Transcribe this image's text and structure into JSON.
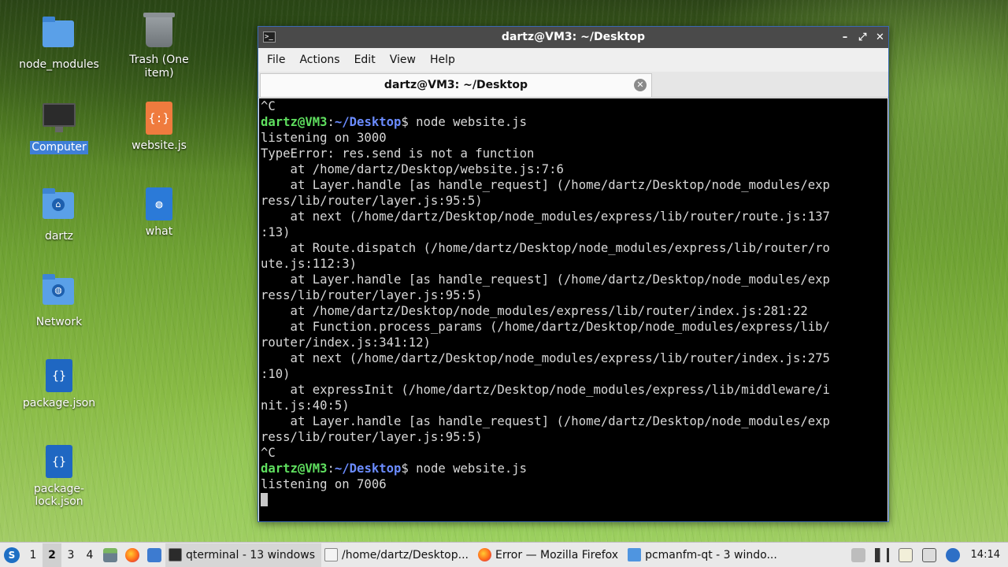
{
  "desktop": {
    "icons": [
      {
        "label": "node_modules"
      },
      {
        "label": "Trash (One item)"
      },
      {
        "label": "Computer"
      },
      {
        "label": "website.js"
      },
      {
        "label": "dartz"
      },
      {
        "label": "what"
      },
      {
        "label": "Network"
      },
      {
        "label": "package.json"
      },
      {
        "label": "package-lock.json"
      }
    ]
  },
  "window": {
    "title": "dartz@VM3: ~/Desktop",
    "controls": {
      "minimize": "–",
      "maximize": "⤢",
      "close": "✕"
    },
    "menu": [
      "File",
      "Actions",
      "Edit",
      "View",
      "Help"
    ],
    "tab_title": "dartz@VM3: ~/Desktop",
    "tab_close": "✕"
  },
  "terminal": {
    "prompt_user": "dartz@VM3",
    "prompt_path": "~/Desktop",
    "lines": [
      "^C",
      "",
      "listening on 3000",
      "TypeError: res.send is not a function",
      "    at /home/dartz/Desktop/website.js:7:6",
      "    at Layer.handle [as handle_request] (/home/dartz/Desktop/node_modules/exp",
      "ress/lib/router/layer.js:95:5)",
      "    at next (/home/dartz/Desktop/node_modules/express/lib/router/route.js:137",
      ":13)",
      "    at Route.dispatch (/home/dartz/Desktop/node_modules/express/lib/router/ro",
      "ute.js:112:3)",
      "    at Layer.handle [as handle_request] (/home/dartz/Desktop/node_modules/exp",
      "ress/lib/router/layer.js:95:5)",
      "    at /home/dartz/Desktop/node_modules/express/lib/router/index.js:281:22",
      "    at Function.process_params (/home/dartz/Desktop/node_modules/express/lib/",
      "router/index.js:341:12)",
      "    at next (/home/dartz/Desktop/node_modules/express/lib/router/index.js:275",
      ":10)",
      "    at expressInit (/home/dartz/Desktop/node_modules/express/lib/middleware/i",
      "nit.js:40:5)",
      "    at Layer.handle [as handle_request] (/home/dartz/Desktop/node_modules/exp",
      "ress/lib/router/layer.js:95:5)",
      "^C",
      "",
      "listening on 7006"
    ],
    "commands": [
      "node website.js",
      "node website.js"
    ]
  },
  "taskbar": {
    "workspaces": [
      "1",
      "2",
      "3",
      "4"
    ],
    "tasks": [
      {
        "label": "qterminal - 13 windows"
      },
      {
        "label": "/home/dartz/Desktop..."
      },
      {
        "label": "Error — Mozilla Firefox"
      },
      {
        "label": "pcmanfm-qt - 3 windo..."
      }
    ],
    "clock": "14:14"
  },
  "colors": {
    "prompt_user": "#5fdf5f",
    "prompt_path": "#6b8cff",
    "titlebar": "#4a4a4a",
    "selection": "#3f7fd6"
  }
}
